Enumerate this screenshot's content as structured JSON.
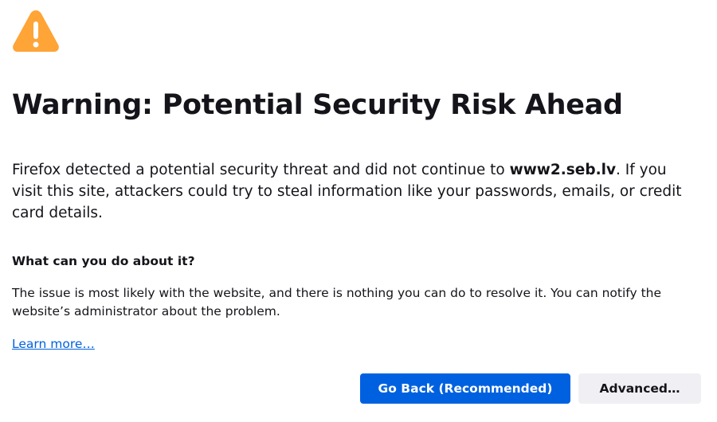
{
  "icon": {
    "name": "warning-icon",
    "color": "#ffa436"
  },
  "title": "Warning: Potential Security Risk Ahead",
  "intro": {
    "before": "Firefox detected a potential security threat and did not continue to ",
    "domain": "www2.seb.lv",
    "after": ". If you visit this site, attackers could try to steal information like your passwords, emails, or credit card details."
  },
  "what_can_you_do": {
    "heading": "What can you do about it?",
    "description": "The issue is most likely with the website, and there is nothing you can do to resolve it. You can notify the website’s administrator about the problem."
  },
  "learn_more": "Learn more…",
  "buttons": {
    "go_back": "Go Back (Recommended)",
    "advanced": "Advanced…"
  },
  "colors": {
    "accent": "#0061e0",
    "text": "#15141a",
    "secondary_button": "#f0f0f4"
  }
}
